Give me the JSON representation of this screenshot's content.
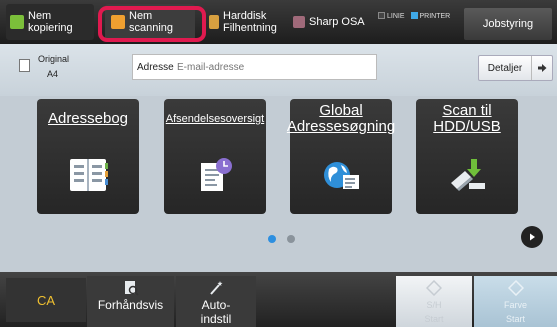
{
  "modes": {
    "copy": {
      "line1": "Nem",
      "line2": "kopiering",
      "icon": "copy-icon"
    },
    "scan": {
      "line1": "Nem",
      "line2": "scanning",
      "icon": "scan-icon"
    },
    "hdd": {
      "line1": "Harddisk",
      "line2": "Filhentning",
      "icon": "hdd-icon"
    },
    "osa": {
      "label": "Sharp OSA",
      "icon": "osa-icon"
    }
  },
  "status": {
    "line": "LINIE",
    "printer": "PRINTER",
    "printer_color": "#3fa8e6"
  },
  "job_status": "Jobstyring",
  "original": {
    "label": "Original",
    "size": "A4"
  },
  "address": {
    "label": "Adresse",
    "placeholder": "E-mail-adresse"
  },
  "details": "Detaljer",
  "tiles": [
    {
      "title": "Adressebog",
      "icon": "address-book-icon"
    },
    {
      "title": "Afsendelsesoversigt",
      "icon": "send-history-icon"
    },
    {
      "title": "Global Adressesøgning",
      "icon": "global-search-icon"
    },
    {
      "title": "Scan til HDD/USB",
      "icon": "scan-to-usb-icon"
    }
  ],
  "pager": {
    "current": 1,
    "total": 2,
    "active_color": "#2d8fe0"
  },
  "bottom": {
    "ca": "CA",
    "preview": "Forhåndsvis",
    "auto": "Auto-\nindstil",
    "bw_start": "S/H\nStart",
    "color_start": "Farve\nStart"
  },
  "highlight_color": "#e01a4f"
}
